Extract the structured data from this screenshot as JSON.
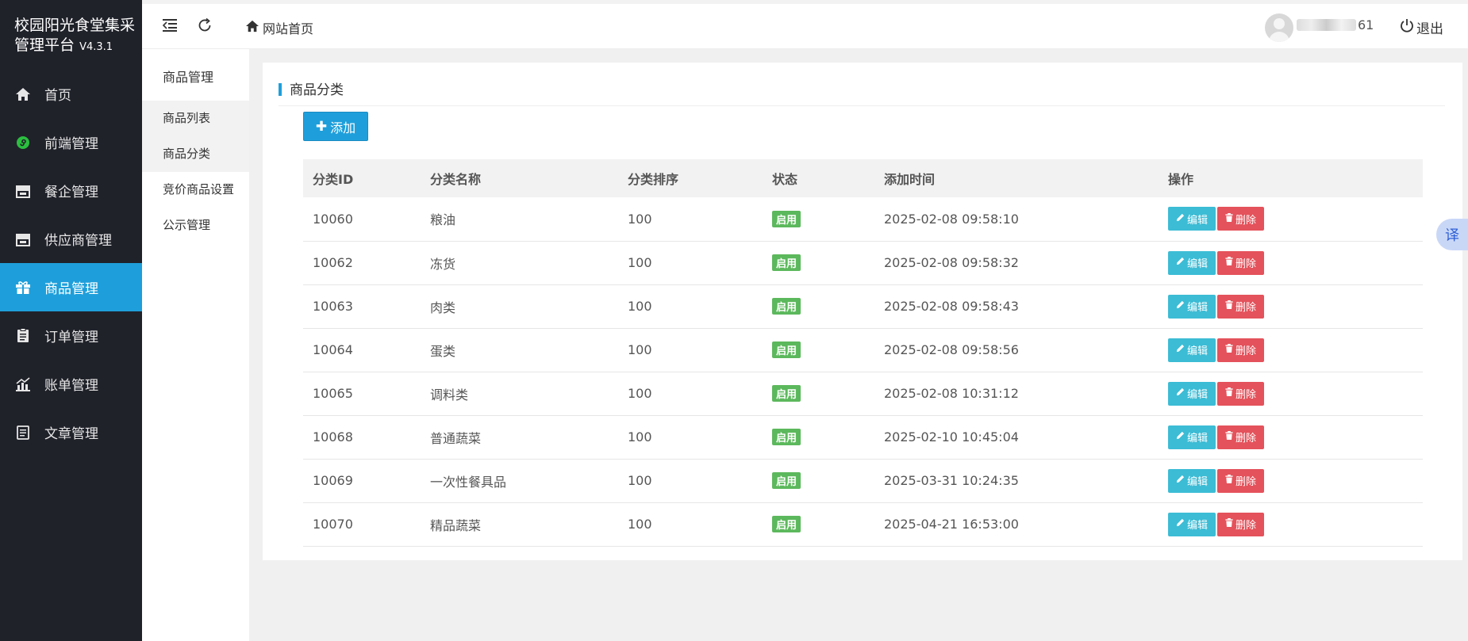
{
  "app": {
    "title": "校园阳光食堂集采管理平台",
    "version": "V4.3.1"
  },
  "sidebar": {
    "items": [
      {
        "label": "首页",
        "icon": "home-icon"
      },
      {
        "label": "前端管理",
        "icon": "mini-program-icon"
      },
      {
        "label": "餐企管理",
        "icon": "store-icon"
      },
      {
        "label": "供应商管理",
        "icon": "store-icon"
      },
      {
        "label": "商品管理",
        "icon": "gift-icon",
        "active": true
      },
      {
        "label": "订单管理",
        "icon": "clipboard-icon"
      },
      {
        "label": "账单管理",
        "icon": "chart-icon"
      },
      {
        "label": "文章管理",
        "icon": "article-icon"
      }
    ]
  },
  "header": {
    "breadcrumb": "网站首页",
    "user_suffix": "61",
    "logout_label": "退出"
  },
  "subnav": {
    "title": "商品管理",
    "items": [
      "商品列表",
      "商品分类",
      "竞价商品设置",
      "公示管理"
    ]
  },
  "main": {
    "title": "商品分类",
    "add_label": "添加",
    "columns": [
      "分类ID",
      "分类名称",
      "分类排序",
      "状态",
      "添加时间",
      "操作"
    ],
    "edit_label": "编辑",
    "delete_label": "删除",
    "rows": [
      {
        "id": "10060",
        "name": "粮油",
        "sort": "100",
        "status": "启用",
        "time": "2025-02-08 09:58:10"
      },
      {
        "id": "10062",
        "name": "冻货",
        "sort": "100",
        "status": "启用",
        "time": "2025-02-08 09:58:32"
      },
      {
        "id": "10063",
        "name": "肉类",
        "sort": "100",
        "status": "启用",
        "time": "2025-02-08 09:58:43"
      },
      {
        "id": "10064",
        "name": "蛋类",
        "sort": "100",
        "status": "启用",
        "time": "2025-02-08 09:58:56"
      },
      {
        "id": "10065",
        "name": "调料类",
        "sort": "100",
        "status": "启用",
        "time": "2025-02-08 10:31:12"
      },
      {
        "id": "10068",
        "name": "普通蔬菜",
        "sort": "100",
        "status": "启用",
        "time": "2025-02-10 10:45:04"
      },
      {
        "id": "10069",
        "name": "一次性餐具品",
        "sort": "100",
        "status": "启用",
        "time": "2025-03-31 10:24:35"
      },
      {
        "id": "10070",
        "name": "精品蔬菜",
        "sort": "100",
        "status": "启用",
        "time": "2025-04-21 16:53:00"
      }
    ]
  },
  "translate_label": "译",
  "colors": {
    "accent": "#1e9fdb",
    "sidebar_bg": "#20222a",
    "success": "#5cb85c",
    "edit": "#3cbcd5",
    "danger": "#e4525b"
  }
}
